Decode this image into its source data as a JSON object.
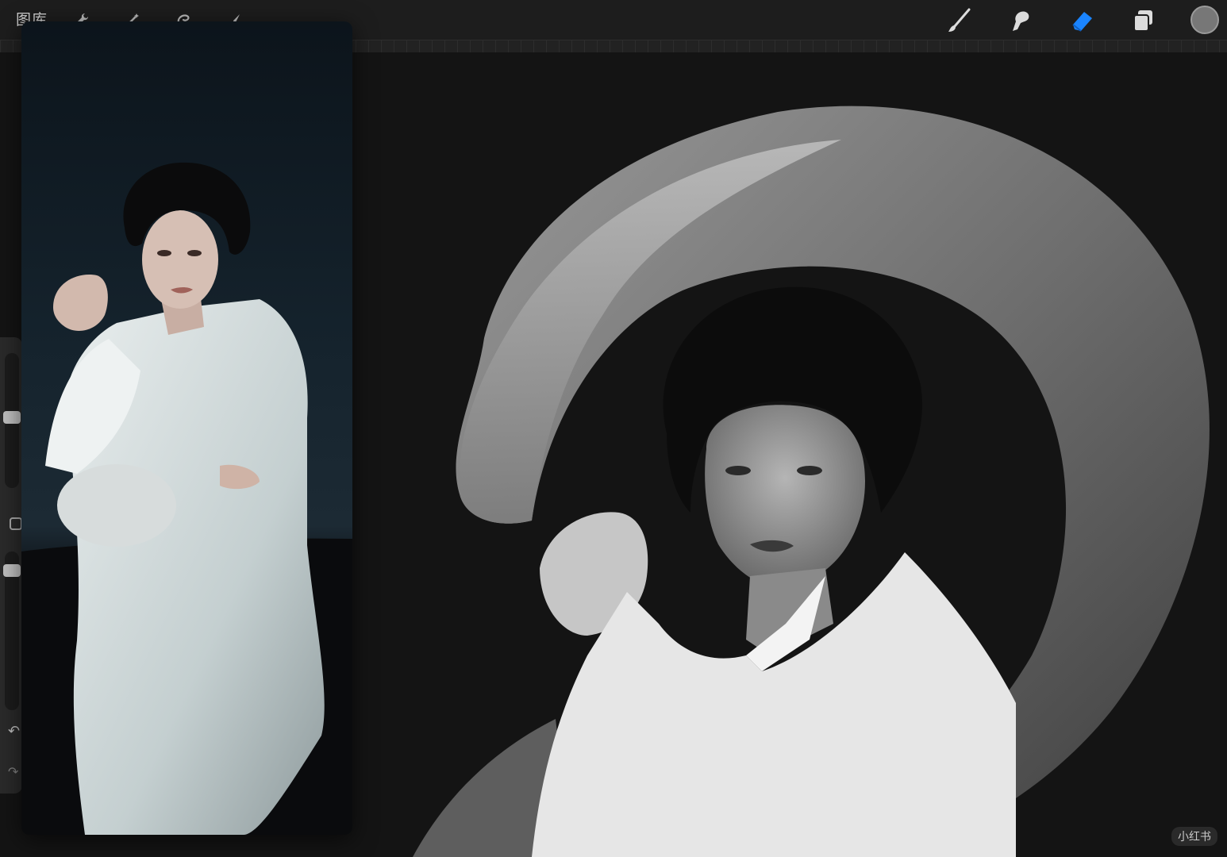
{
  "topbar": {
    "gallery_label": "图库",
    "left_tools": [
      {
        "name": "actions",
        "icon": "wrench-icon"
      },
      {
        "name": "adjustments",
        "icon": "magic-wand-icon"
      },
      {
        "name": "selection",
        "icon": "selection-icon"
      },
      {
        "name": "transform",
        "icon": "arrow-cursor-icon"
      }
    ],
    "right_tools": [
      {
        "name": "brush",
        "icon": "brush-icon",
        "active": false
      },
      {
        "name": "smudge",
        "icon": "smudge-finger-icon",
        "active": false
      },
      {
        "name": "eraser",
        "icon": "eraser-icon",
        "active": true
      },
      {
        "name": "layers",
        "icon": "layers-icon",
        "active": false
      }
    ],
    "current_color": "#777777",
    "accent_color": "#1a84ff"
  },
  "sidebar": {
    "brush_size_icon": "brush-size-slider",
    "modify_icon": "square-modify-icon",
    "opacity_icon": "opacity-slider",
    "undo_icon": "undo-arrow-icon",
    "redo_icon": "redo-arrow-icon"
  },
  "reference_window": {
    "content": "reference-photo"
  },
  "canvas": {
    "content": "grayscale-portrait-artwork"
  },
  "watermark": "小红书"
}
